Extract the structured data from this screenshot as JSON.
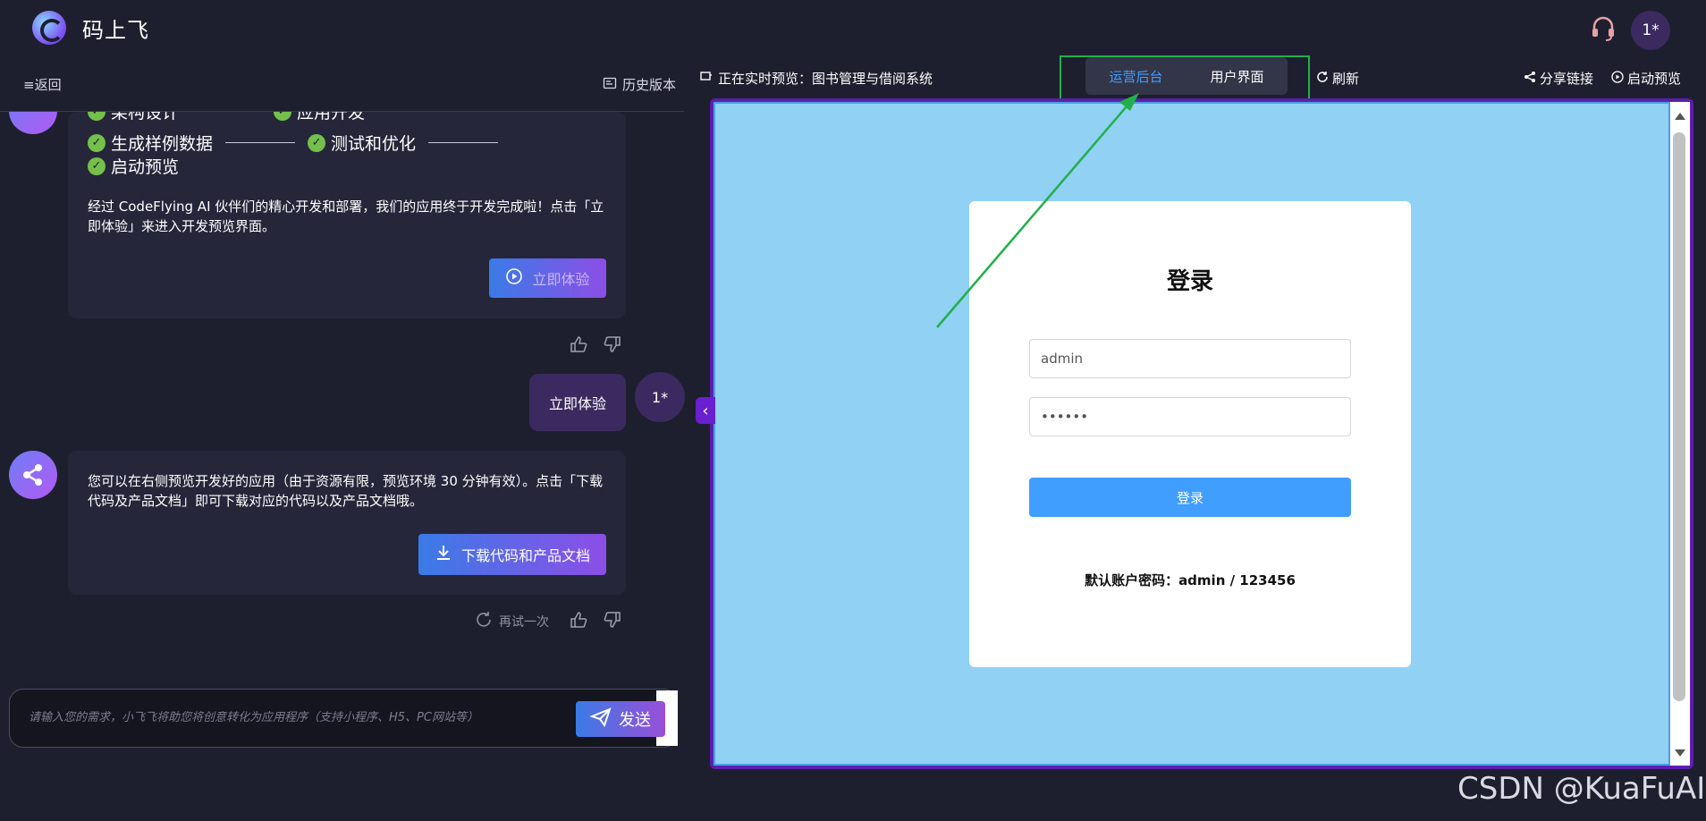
{
  "header": {
    "brand": "码上飞",
    "user_initials": "1*"
  },
  "left": {
    "back_label": "≡返回",
    "history_label": "历史版本",
    "steps": [
      [
        "架构设计",
        "应用开发"
      ],
      [
        "生成样例数据",
        "测试和优化"
      ],
      [
        "启动预览"
      ]
    ],
    "msg1_text": "经过 CodeFlying AI 伙伴们的精心开发和部署，我们的应用终于开发完成啦！点击「立即体验」来进入开发预览界面。",
    "try_button": "立即体验",
    "user_message": "立即体验",
    "user_initials": "1*",
    "msg2_text": "您可以在右侧预览开发好的应用（由于资源有限，预览环境 30 分钟有效）。点击「下载代码及产品文档」即可下载对应的代码以及产品文档哦。",
    "download_button": "下载代码和产品文档",
    "retry_label": "再试一次",
    "input_placeholder": "请输入您的需求，小飞飞将助您将创意转化为应用程序（支持小程序、H5、PC网站等）",
    "send_label": "发送"
  },
  "right": {
    "preview_label": "正在实时预览：图书管理与借阅系统",
    "tabs": [
      "运营后台",
      "用户界面"
    ],
    "active_tab": "运营后台",
    "refresh_label": "刷新",
    "share_label": "分享链接",
    "launch_label": "启动预览",
    "login": {
      "title": "登录",
      "username": "admin",
      "password": "••••••",
      "button": "登录",
      "hint": "默认账户密码：admin / 123456"
    }
  },
  "watermark": "CSDN @KuaFuAI",
  "colors": {
    "accent": "#409eff",
    "highlight": "#22b04a",
    "bg": "#1e1f2e"
  }
}
